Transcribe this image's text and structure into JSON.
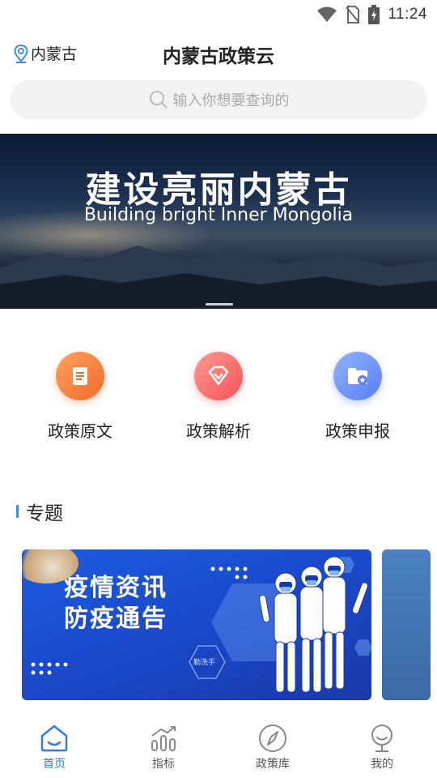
{
  "status_bar": {
    "time": "11:24"
  },
  "header": {
    "location": "内蒙古",
    "title": "内蒙古政策云"
  },
  "search": {
    "placeholder": "输入你想要查询的"
  },
  "banner": {
    "title": "建设亮丽内蒙古",
    "subtitle": "Building bright Inner Mongolia"
  },
  "quick_actions": [
    {
      "label": "政策原文",
      "icon": "document-icon",
      "color": "#f26a2c"
    },
    {
      "label": "政策解析",
      "icon": "gem-icon",
      "color": "#f5525a"
    },
    {
      "label": "政策申报",
      "icon": "folder-star-icon",
      "color": "#5a7df5"
    }
  ],
  "section": {
    "title": "专题",
    "accent": "#3d8bf0"
  },
  "topic_card": {
    "line1": "疫情资讯",
    "line2": "防疫通告",
    "badge": "勤洗手"
  },
  "bottom_nav": [
    {
      "label": "首页",
      "icon": "home-icon",
      "active": true
    },
    {
      "label": "指标",
      "icon": "chart-icon",
      "active": false
    },
    {
      "label": "政策库",
      "icon": "compass-icon",
      "active": false
    },
    {
      "label": "我的",
      "icon": "profile-icon",
      "active": false
    }
  ],
  "accent_color": "#2f7be6"
}
